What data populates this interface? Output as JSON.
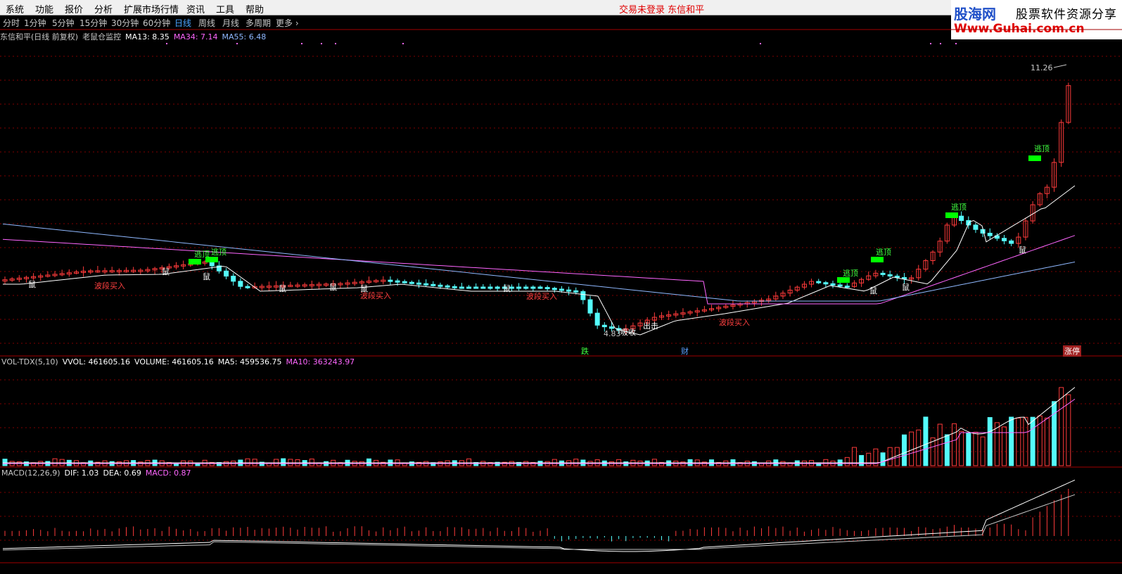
{
  "menu": [
    "系统",
    "功能",
    "报价",
    "分析",
    "扩展市场行情",
    "资讯",
    "工具",
    "帮助"
  ],
  "login_status": "交易未登录  东信和平",
  "brand": {
    "name_blue": "股海网",
    "name_black": "股票软件资源分享",
    "url": "Www.Guhai.com.cn"
  },
  "periods": [
    "分时",
    "1分钟",
    "5分钟",
    "15分钟",
    "30分钟",
    "60分钟",
    "日线",
    "周线",
    "月线",
    "多周期",
    "更多"
  ],
  "active_period": "日线",
  "main_panel": {
    "stock": "东信和平(日线 前复权)",
    "indicator": "老鼠仓监控",
    "ma13": "MA13: 8.35",
    "ma34": "MA34: 7.14",
    "ma55": "MA55: 6.48",
    "high_label": "11.26",
    "low_label": "4.83",
    "signals": {
      "escape": "逃顶",
      "buy": "波段买入",
      "rat": "鼠",
      "strike": "出击",
      "absorb": "吸收"
    },
    "markers": {
      "fall": "跌",
      "cai": "财",
      "limit": "涨停"
    }
  },
  "volume_panel": {
    "name": "VOL-TDX(5,10)",
    "vvol": "VVOL: 461605.16",
    "volume": "VOLUME: 461605.16",
    "ma5": "MA5: 459536.75",
    "ma10": "MA10: 363243.97"
  },
  "macd_panel": {
    "name": "MACD(12,26,9)",
    "dif": "DIF: 1.03",
    "dea": "DEA: 0.69",
    "macd": "MACD: 0.87"
  },
  "colors": {
    "up": "#ff3b3b",
    "down": "#54fcfc",
    "ma13": "#ffffff",
    "ma34": "#ff66ff",
    "ma55": "#8fb8ff",
    "grid": "#800000",
    "signal_green": "#00ff00",
    "signal_text_red": "#ff4040"
  },
  "chart_data": {
    "type": "candlestick",
    "price_range": [
      4.83,
      11.26
    ],
    "ma13_last": 8.35,
    "ma34_last": 7.14,
    "ma55_last": 6.48,
    "vol_last": 461605.16,
    "vol_ma5_last": 459536.75,
    "vol_ma10_last": 363243.97,
    "dif_last": 1.03,
    "dea_last": 0.69,
    "macd_last": 0.87
  }
}
